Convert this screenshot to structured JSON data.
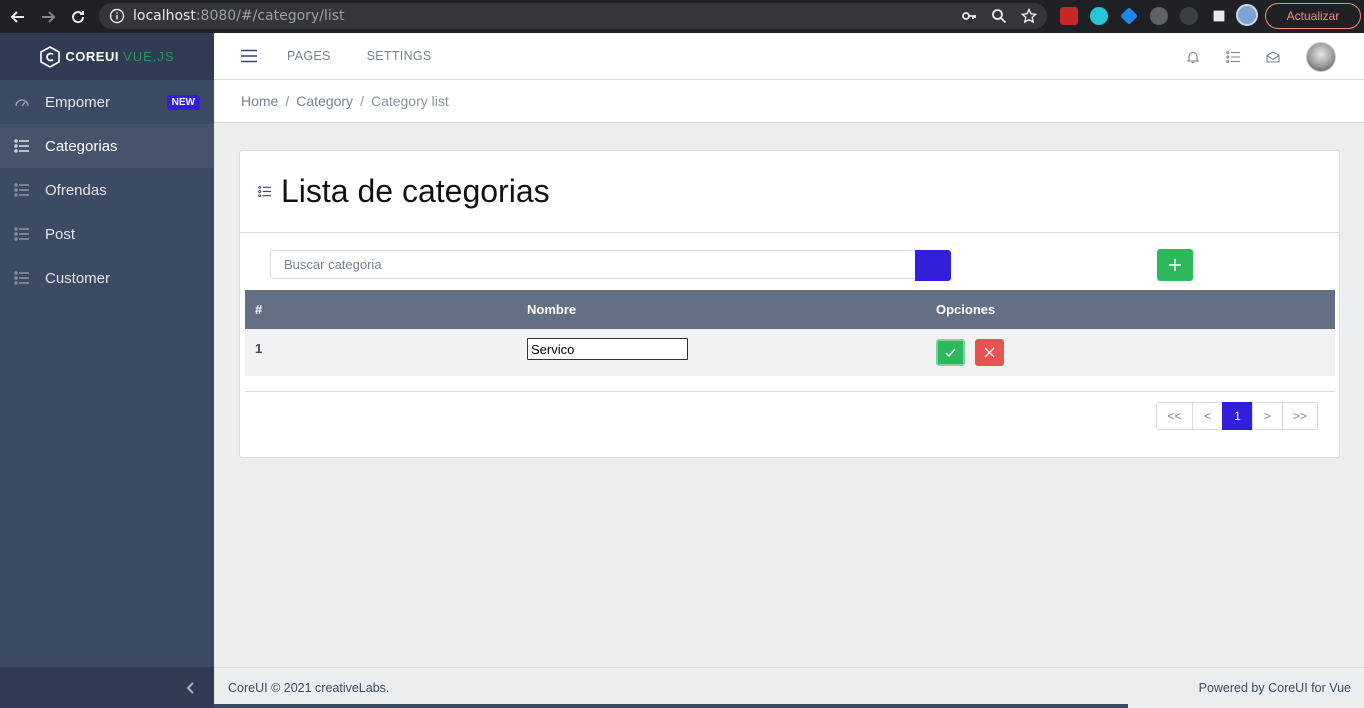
{
  "browser": {
    "url_host": "localhost",
    "url_path": ":8080/#/category/list",
    "update_label": "Actualizar"
  },
  "sidebar": {
    "brand": "COREUI",
    "brand_suffix": "VUE.JS",
    "items": [
      {
        "label": "Empomer",
        "badge": "NEW",
        "icon": "speedometer-icon",
        "active": false
      },
      {
        "label": "Categorias",
        "icon": "list-icon",
        "active": true
      },
      {
        "label": "Ofrendas",
        "icon": "list-icon",
        "active": false
      },
      {
        "label": "Post",
        "icon": "list-icon",
        "active": false
      },
      {
        "label": "Customer",
        "icon": "list-icon",
        "active": false
      }
    ]
  },
  "header": {
    "nav": [
      "PAGES",
      "SETTINGS"
    ],
    "icons": [
      "bell-icon",
      "list-icon",
      "envelope-icon"
    ]
  },
  "breadcrumb": {
    "home": "Home",
    "category": "Category",
    "current": "Category list",
    "separator": "/"
  },
  "card": {
    "title": "Lista de categorias",
    "search_placeholder": "Buscar categoria",
    "add_symbol": "+"
  },
  "table": {
    "columns": [
      "#",
      "Nombre",
      "Opciones"
    ],
    "rows": [
      {
        "num": "1",
        "name": "Servico"
      }
    ]
  },
  "pagination": {
    "first": "<<",
    "prev": "<",
    "current": "1",
    "next": ">",
    "last": ">>"
  },
  "footer": {
    "left": "CoreUI © 2021 creativeLabs.",
    "right": "Powered by CoreUI for Vue"
  },
  "colors": {
    "primary": "#321fdb",
    "success": "#2eb85c",
    "danger": "#e55353",
    "sidebar": "#3c4b64"
  }
}
